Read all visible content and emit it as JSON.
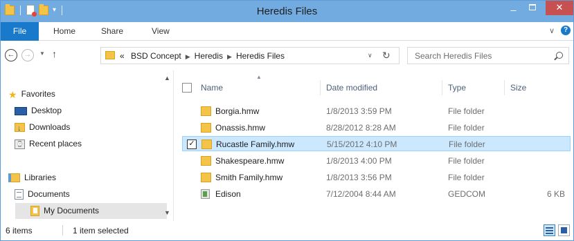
{
  "window": {
    "title": "Heredis Files"
  },
  "ribbon": {
    "tabs": [
      {
        "label": "File"
      },
      {
        "label": "Home"
      },
      {
        "label": "Share"
      },
      {
        "label": "View"
      }
    ],
    "help": "?"
  },
  "address": {
    "prefix": "«",
    "crumbs": [
      "BSD Concept",
      "Heredis",
      "Heredis Files"
    ]
  },
  "search": {
    "placeholder": "Search Heredis Files"
  },
  "nav": {
    "favorites": "Favorites",
    "desktop": "Desktop",
    "downloads": "Downloads",
    "recent": "Recent places",
    "libraries": "Libraries",
    "documents": "Documents",
    "my_documents": "My Documents"
  },
  "columns": {
    "name": "Name",
    "date": "Date modified",
    "type": "Type",
    "size": "Size"
  },
  "files": [
    {
      "name": "Borgia.hmw",
      "date": "1/8/2013 3:59 PM",
      "type": "File folder",
      "size": "",
      "icon": "folder-icon",
      "selected": false
    },
    {
      "name": "Onassis.hmw",
      "date": "8/28/2012 8:28 AM",
      "type": "File folder",
      "size": "",
      "icon": "folder-icon",
      "selected": false
    },
    {
      "name": "Rucastle Family.hmw",
      "date": "5/15/2012 4:10 PM",
      "type": "File folder",
      "size": "",
      "icon": "folder-icon",
      "selected": true
    },
    {
      "name": "Shakespeare.hmw",
      "date": "1/8/2013 4:00 PM",
      "type": "File folder",
      "size": "",
      "icon": "folder-icon",
      "selected": false
    },
    {
      "name": "Smith Family.hmw",
      "date": "1/8/2013 3:56 PM",
      "type": "File folder",
      "size": "",
      "icon": "folder-icon",
      "selected": false
    },
    {
      "name": "Edison",
      "date": "7/12/2004 8:44 AM",
      "type": "GEDCOM",
      "size": "6 KB",
      "icon": "gedcom-file-icon",
      "selected": false
    }
  ],
  "status": {
    "count": "6 items",
    "selection": "1 item selected"
  },
  "colors": {
    "titlebar": "#71abe0",
    "file_tab": "#1979ca",
    "close": "#c75050",
    "selection": "#cce8ff"
  }
}
